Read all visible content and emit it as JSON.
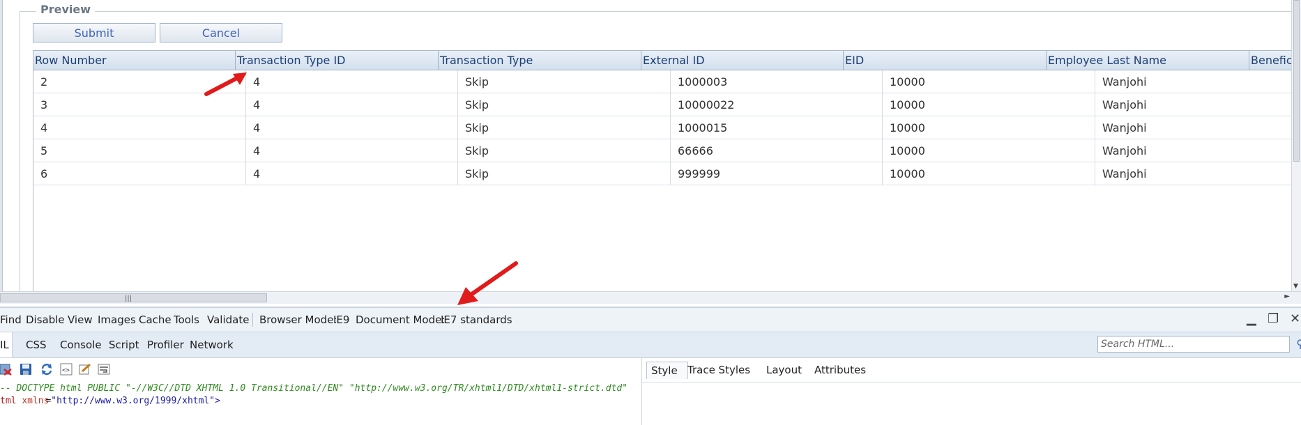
{
  "preview": {
    "legend": "Preview",
    "submit_label": "Submit",
    "cancel_label": "Cancel"
  },
  "grid": {
    "headers": [
      "Row Number",
      "Transaction Type ID",
      "Transaction Type",
      "External ID",
      "EID",
      "Employee Last Name",
      "Beneficia"
    ],
    "rows": [
      [
        "2",
        "4",
        "Skip",
        "1000003",
        "10000",
        "Wanjohi"
      ],
      [
        "3",
        "4",
        "Skip",
        "10000022",
        "10000",
        "Wanjohi"
      ],
      [
        "4",
        "4",
        "Skip",
        "1000015",
        "10000",
        "Wanjohi"
      ],
      [
        "5",
        "4",
        "Skip",
        "66666",
        "10000",
        "Wanjohi"
      ],
      [
        "6",
        "4",
        "Skip",
        "999999",
        "10000",
        "Wanjohi"
      ]
    ]
  },
  "devtools": {
    "menu": [
      "Find",
      "Disable",
      "View",
      "Images",
      "Cache",
      "Tools",
      "Validate"
    ],
    "browser_mode_label": "Browser Mode:",
    "browser_mode_value": "IE9",
    "document_mode_label": "Document Mode:",
    "document_mode_value": "IE7 standards",
    "tabs": [
      "IL",
      "CSS",
      "Console",
      "Script",
      "Profiler",
      "Network"
    ],
    "search_placeholder": "Search HTML...",
    "right_tabs": [
      "Style",
      "Trace Styles",
      "Layout",
      "Attributes"
    ],
    "code": {
      "doctype": "-- DOCTYPE html PUBLIC \"-//W3C//DTD XHTML 1.0 Transitional//EN\" \"http://www.w3.org/TR/xhtml1/DTD/xhtml1-strict.dtd\"",
      "html_tag": "tml",
      "attr_name": "xmlns",
      "attr_eq": "=",
      "attr_value": "\"http://www.w3.org/1999/xhtml\"",
      "tag_close": ">"
    }
  },
  "colors": {
    "arrow": "#e11b1b",
    "header_text": "#1e3f73",
    "button_text": "#3e64b8"
  }
}
